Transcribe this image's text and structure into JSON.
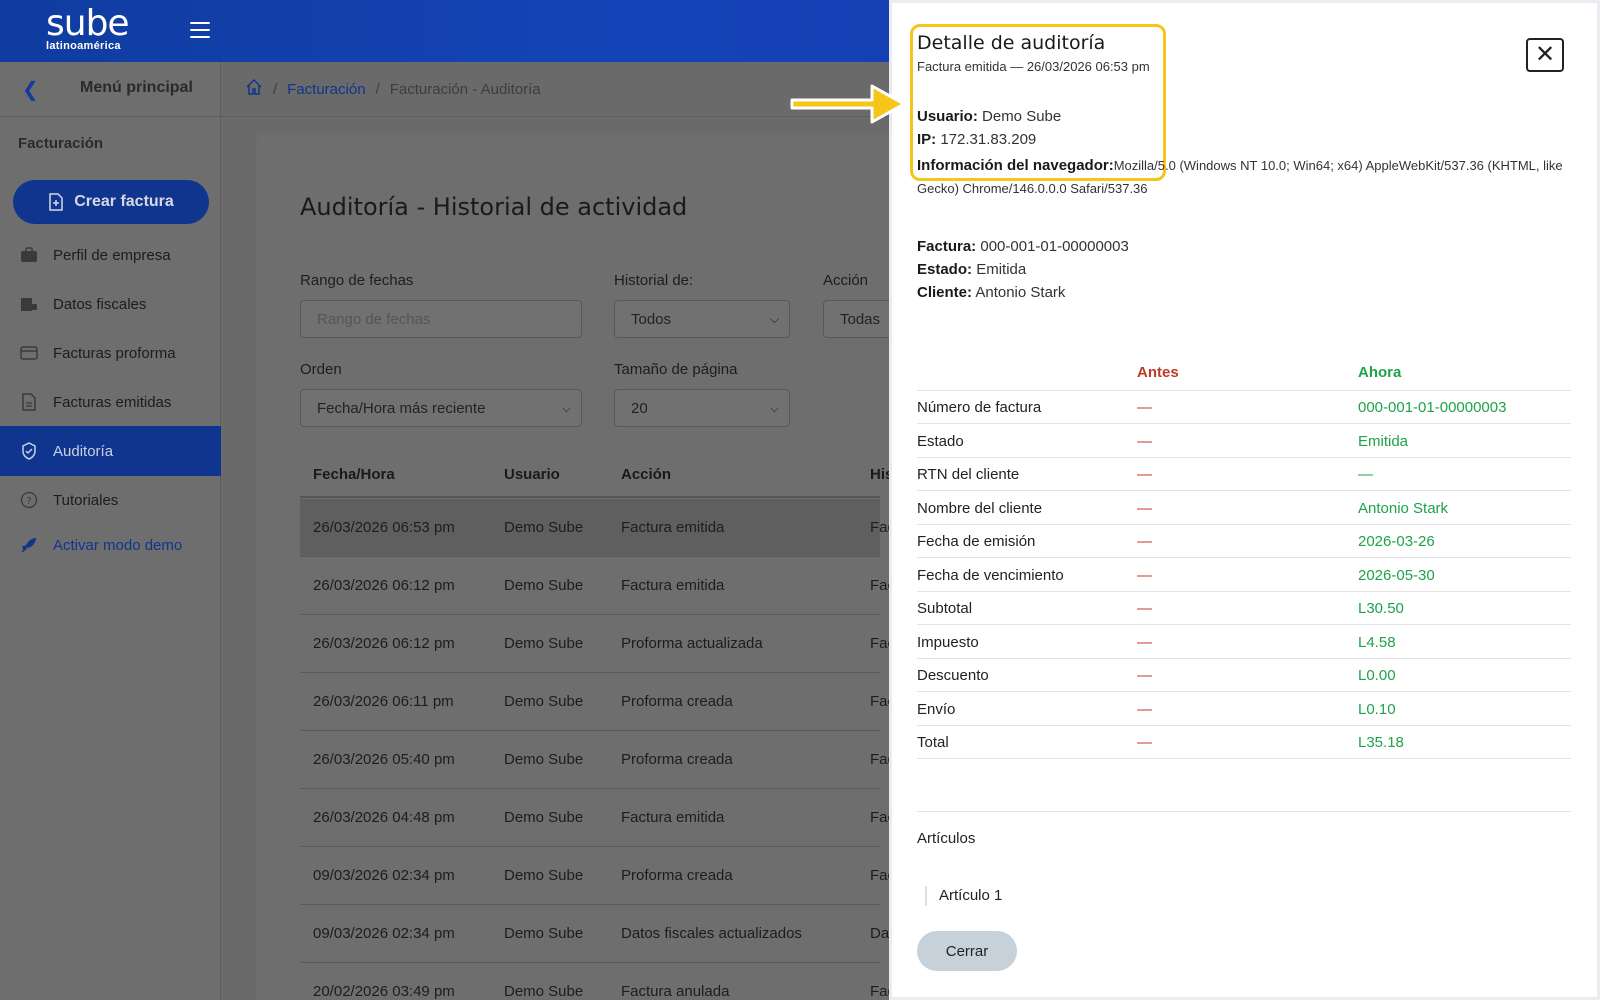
{
  "app": {
    "logo_main": "sube",
    "logo_sub": "latinoamérica"
  },
  "sidebar": {
    "title": "Menú principal",
    "section": "Facturación",
    "create_button": "Crear factura",
    "items": [
      {
        "label": "Perfil de empresa",
        "icon": "briefcase-icon"
      },
      {
        "label": "Datos fiscales",
        "icon": "building-lock-icon"
      },
      {
        "label": "Facturas proforma",
        "icon": "card-icon"
      },
      {
        "label": "Facturas emitidas",
        "icon": "document-icon"
      },
      {
        "label": "Auditoría",
        "icon": "shield-check-icon",
        "active": true
      },
      {
        "label": "Tutoriales",
        "icon": "question-circle-icon"
      }
    ],
    "demo_link": "Activar modo demo"
  },
  "breadcrumb": {
    "home_icon": "home-icon",
    "link": "Facturación",
    "current": "Facturación - Auditoría"
  },
  "main": {
    "title": "Auditoría - Historial de actividad",
    "filters": {
      "date_range_label": "Rango de fechas",
      "date_range_placeholder": "Rango de fechas",
      "history_label": "Historial de:",
      "history_value": "Todos",
      "action_label": "Acción",
      "action_value": "Todas",
      "order_label": "Orden",
      "order_value": "Fecha/Hora más reciente",
      "page_size_label": "Tamaño de página",
      "page_size_value": "20"
    },
    "table": {
      "headers": [
        "Fecha/Hora",
        "Usuario",
        "Acción",
        "His"
      ],
      "rows": [
        [
          "26/03/2026 06:53 pm",
          "Demo Sube",
          "Factura emitida",
          "Fac"
        ],
        [
          "26/03/2026 06:12 pm",
          "Demo Sube",
          "Factura emitida",
          "Fac"
        ],
        [
          "26/03/2026 06:12 pm",
          "Demo Sube",
          "Proforma actualizada",
          "Fac"
        ],
        [
          "26/03/2026 06:11 pm",
          "Demo Sube",
          "Proforma creada",
          "Fac"
        ],
        [
          "26/03/2026 05:40 pm",
          "Demo Sube",
          "Proforma creada",
          "Fac"
        ],
        [
          "26/03/2026 04:48 pm",
          "Demo Sube",
          "Factura emitida",
          "Fac"
        ],
        [
          "09/03/2026 02:34 pm",
          "Demo Sube",
          "Proforma creada",
          "Fac"
        ],
        [
          "09/03/2026 02:34 pm",
          "Demo Sube",
          "Datos fiscales actualizados",
          "Da"
        ],
        [
          "20/02/2026 03:49 pm",
          "Demo Sube",
          "Factura anulada",
          "Fac"
        ]
      ]
    }
  },
  "panel": {
    "title": "Detalle de auditoría",
    "subtitle": "Factura emitida — 26/03/2026 06:53 pm",
    "close_icon": "close-icon",
    "user_label": "Usuario:",
    "user_value": "Demo Sube",
    "ip_label": "IP:",
    "ip_value": "172.31.83.209",
    "browser_label": "Información del navegador:",
    "browser_value": "Mozilla/5.0 (Windows NT 10.0; Win64; x64) AppleWebKit/537.36 (KHTML, like Gecko) Chrome/146.0.0.0 Safari/537.36",
    "invoice_label": "Factura:",
    "invoice_value": "000-001-01-00000003",
    "status_label": "Estado:",
    "status_value": "Emitida",
    "client_label": "Cliente:",
    "client_value": "Antonio Stark",
    "compare": {
      "before_header": "Antes",
      "after_header": "Ahora",
      "rows": [
        {
          "label": "Número de factura",
          "before": "—",
          "after": "000-001-01-00000003"
        },
        {
          "label": "Estado",
          "before": "—",
          "after": "Emitida"
        },
        {
          "label": "RTN del cliente",
          "before": "—",
          "after": "—"
        },
        {
          "label": "Nombre del cliente",
          "before": "—",
          "after": "Antonio Stark"
        },
        {
          "label": "Fecha de emisión",
          "before": "—",
          "after": "2026-03-26"
        },
        {
          "label": "Fecha de vencimiento",
          "before": "—",
          "after": "2026-05-30"
        },
        {
          "label": "Subtotal",
          "before": "—",
          "after": "L30.50"
        },
        {
          "label": "Impuesto",
          "before": "—",
          "after": "L4.58"
        },
        {
          "label": "Descuento",
          "before": "—",
          "after": "L0.00"
        },
        {
          "label": "Envío",
          "before": "—",
          "after": "L0.10"
        },
        {
          "label": "Total",
          "before": "—",
          "after": "L35.18"
        }
      ]
    },
    "items_title": "Artículos",
    "item_1": "Artículo 1",
    "close_button": "Cerrar"
  },
  "colors": {
    "brand": "#1444b8",
    "before": "#c0392b",
    "after": "#1ea34a",
    "highlight": "#f5c518"
  }
}
